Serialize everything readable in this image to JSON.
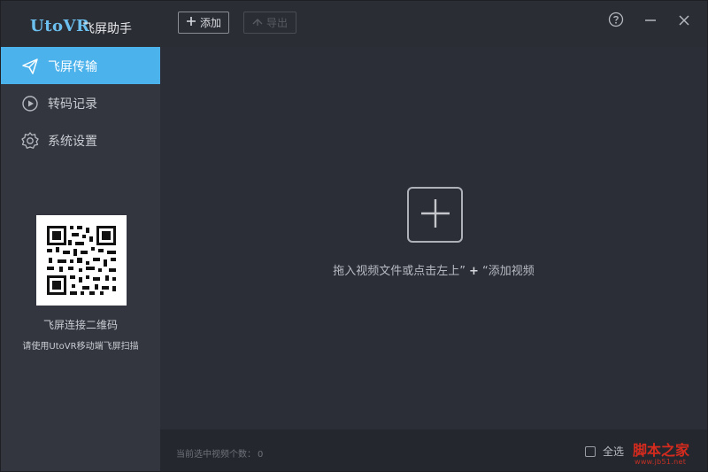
{
  "brand": {
    "logo": "UtoVR",
    "title": "飞屏助手"
  },
  "toolbar": {
    "add_label": "添加",
    "export_label": "导出"
  },
  "sidebar": {
    "items": [
      {
        "label": "飞屏传输",
        "icon": "paper-plane-icon",
        "active": true
      },
      {
        "label": "转码记录",
        "icon": "play-circle-icon",
        "active": false
      },
      {
        "label": "系统设置",
        "icon": "gear-icon",
        "active": false
      }
    ],
    "qr_caption": "飞屏连接二维码",
    "qr_hint": "请使用UtoVR移动端飞屏扫描"
  },
  "main": {
    "drop_hint_before": "拖入视频文件或点击左上”",
    "drop_hint_after": "“添加视频"
  },
  "footer": {
    "count_label": "当前选中视频个数：",
    "count_value": "0",
    "select_all_label": "全选"
  },
  "watermark": {
    "title": "脚本之家",
    "url": "www.jb51.net"
  },
  "colors": {
    "accent": "#4cb2ec",
    "sidebar_bg": "#33363e",
    "main_bg": "#2b2e37",
    "watermark": "#d42b1e"
  }
}
